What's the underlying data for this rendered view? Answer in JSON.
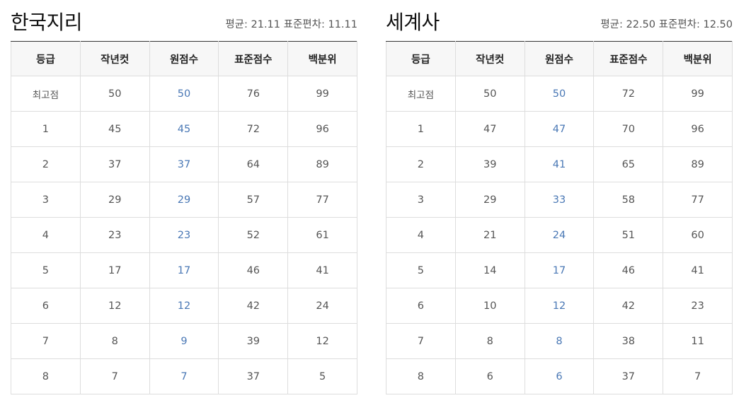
{
  "colors": {
    "raw_score_text": "#4a78b5",
    "header_background": "#f7f7f7",
    "table_top_border": "#333333"
  },
  "panels": [
    {
      "title": "한국지리",
      "mean_label": "평균: 21.11",
      "std_label": "표준편차: 11.11",
      "columns": [
        "등급",
        "작년컷",
        "원점수",
        "표준점수",
        "백분위"
      ],
      "rows": [
        {
          "grade": "최고점",
          "last_year_cut": "50",
          "raw_score": "50",
          "standard_score": "76",
          "percentile": "99"
        },
        {
          "grade": "1",
          "last_year_cut": "45",
          "raw_score": "45",
          "standard_score": "72",
          "percentile": "96"
        },
        {
          "grade": "2",
          "last_year_cut": "37",
          "raw_score": "37",
          "standard_score": "64",
          "percentile": "89"
        },
        {
          "grade": "3",
          "last_year_cut": "29",
          "raw_score": "29",
          "standard_score": "57",
          "percentile": "77"
        },
        {
          "grade": "4",
          "last_year_cut": "23",
          "raw_score": "23",
          "standard_score": "52",
          "percentile": "61"
        },
        {
          "grade": "5",
          "last_year_cut": "17",
          "raw_score": "17",
          "standard_score": "46",
          "percentile": "41"
        },
        {
          "grade": "6",
          "last_year_cut": "12",
          "raw_score": "12",
          "standard_score": "42",
          "percentile": "24"
        },
        {
          "grade": "7",
          "last_year_cut": "8",
          "raw_score": "9",
          "standard_score": "39",
          "percentile": "12"
        },
        {
          "grade": "8",
          "last_year_cut": "7",
          "raw_score": "7",
          "standard_score": "37",
          "percentile": "5"
        }
      ]
    },
    {
      "title": "세계사",
      "mean_label": "평균: 22.50",
      "std_label": "표준편차: 12.50",
      "columns": [
        "등급",
        "작년컷",
        "원점수",
        "표준점수",
        "백분위"
      ],
      "rows": [
        {
          "grade": "최고점",
          "last_year_cut": "50",
          "raw_score": "50",
          "standard_score": "72",
          "percentile": "99"
        },
        {
          "grade": "1",
          "last_year_cut": "47",
          "raw_score": "47",
          "standard_score": "70",
          "percentile": "96"
        },
        {
          "grade": "2",
          "last_year_cut": "39",
          "raw_score": "41",
          "standard_score": "65",
          "percentile": "89"
        },
        {
          "grade": "3",
          "last_year_cut": "29",
          "raw_score": "33",
          "standard_score": "58",
          "percentile": "77"
        },
        {
          "grade": "4",
          "last_year_cut": "21",
          "raw_score": "24",
          "standard_score": "51",
          "percentile": "60"
        },
        {
          "grade": "5",
          "last_year_cut": "14",
          "raw_score": "17",
          "standard_score": "46",
          "percentile": "41"
        },
        {
          "grade": "6",
          "last_year_cut": "10",
          "raw_score": "12",
          "standard_score": "42",
          "percentile": "23"
        },
        {
          "grade": "7",
          "last_year_cut": "8",
          "raw_score": "8",
          "standard_score": "38",
          "percentile": "11"
        },
        {
          "grade": "8",
          "last_year_cut": "6",
          "raw_score": "6",
          "standard_score": "37",
          "percentile": "7"
        }
      ]
    }
  ]
}
